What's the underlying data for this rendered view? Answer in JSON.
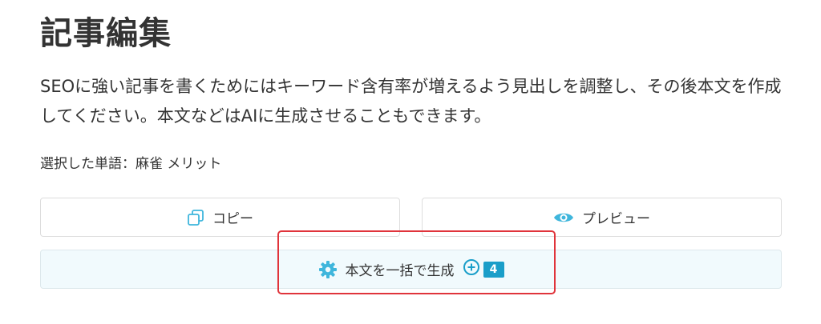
{
  "page": {
    "title": "記事編集",
    "description": "SEOに強い記事を書くためにはキーワード含有率が増えるよう見出しを調整し、その後本文を作成してください。本文などはAIに生成させることもできます。",
    "selected_words": "選択した単語：麻雀 メリット"
  },
  "actions": {
    "copy_label": "コピー",
    "preview_label": "プレビュー",
    "generate_label": "本文を一括で生成",
    "credit_count": "4"
  },
  "colors": {
    "accent": "#1a9ec9",
    "icon_blue": "#3fb6dc",
    "generate_bg": "#f1fafd",
    "highlight": "#e0343b"
  },
  "icons": {
    "copy": "copy-icon",
    "preview": "eye-icon",
    "generate": "gear-icon",
    "credit": "plus-circle-icon"
  }
}
